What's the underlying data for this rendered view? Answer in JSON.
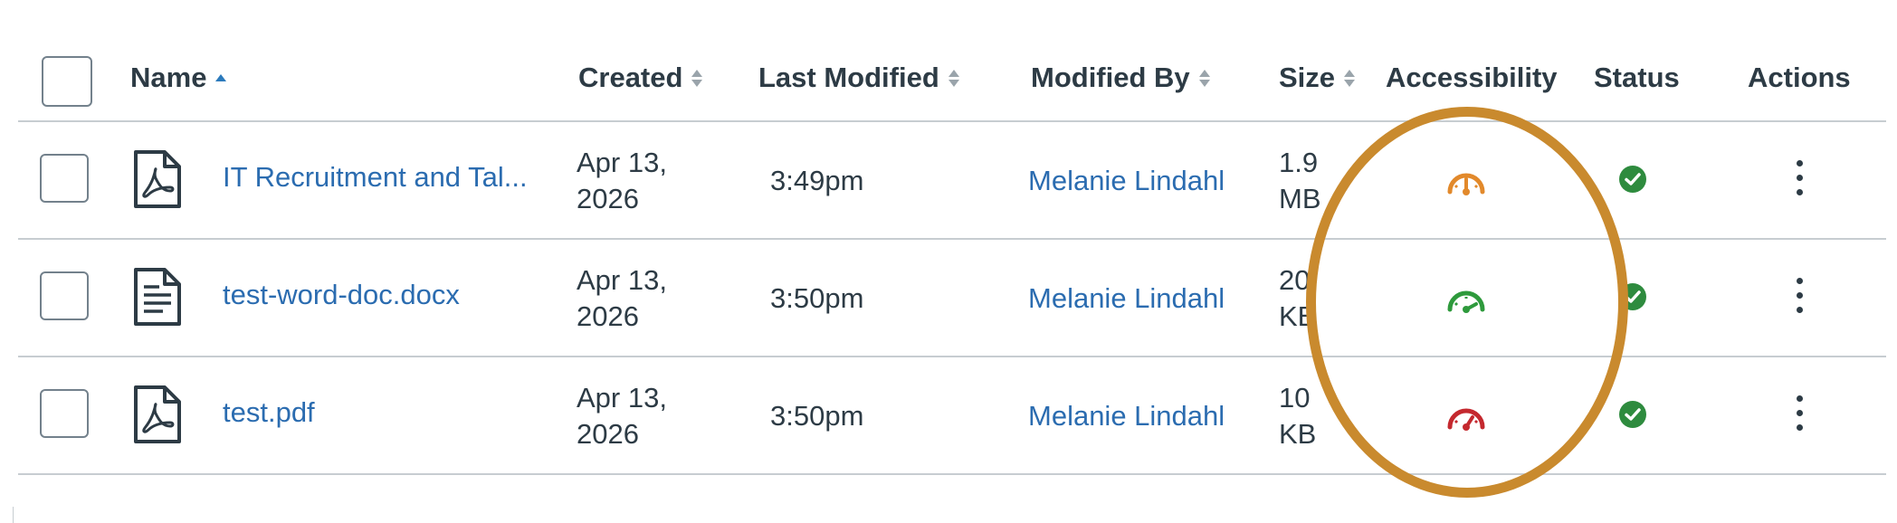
{
  "table": {
    "columns": {
      "name": "Name",
      "created": "Created",
      "last_modified": "Last Modified",
      "modified_by": "Modified By",
      "size": "Size",
      "accessibility": "Accessibility",
      "status": "Status",
      "actions": "Actions"
    },
    "rows": [
      {
        "name": "IT Recruitment and Tal...",
        "icon": "pdf-file-icon",
        "created_line1": "Apr 13,",
        "created_line2": "2026",
        "modified": "3:49pm",
        "modified_by": "Melanie Lindahl",
        "size_line1": "1.9",
        "size_line2": "MB",
        "accessibility": "gauge-medium-icon",
        "accessibility_color": "#e2892b",
        "status": "published-check-icon"
      },
      {
        "name": "test-word-doc.docx",
        "icon": "document-file-icon",
        "created_line1": "Apr 13,",
        "created_line2": "2026",
        "modified": "3:50pm",
        "modified_by": "Melanie Lindahl",
        "size_line1": "20",
        "size_line2": "KB",
        "accessibility": "gauge-high-icon",
        "accessibility_color": "#2e9a3c",
        "status": "published-check-icon"
      },
      {
        "name": "test.pdf",
        "icon": "pdf-file-icon",
        "created_line1": "Apr 13,",
        "created_line2": "2026",
        "modified": "3:50pm",
        "modified_by": "Melanie Lindahl",
        "size_line1": "10",
        "size_line2": "KB",
        "accessibility": "gauge-low-icon",
        "accessibility_color": "#c4282e",
        "status": "published-check-icon"
      }
    ]
  },
  "colors": {
    "link": "#2b6cb0",
    "text": "#2d3b45",
    "status_green": "#2e8b3e",
    "annotation": "#c98a2e"
  }
}
